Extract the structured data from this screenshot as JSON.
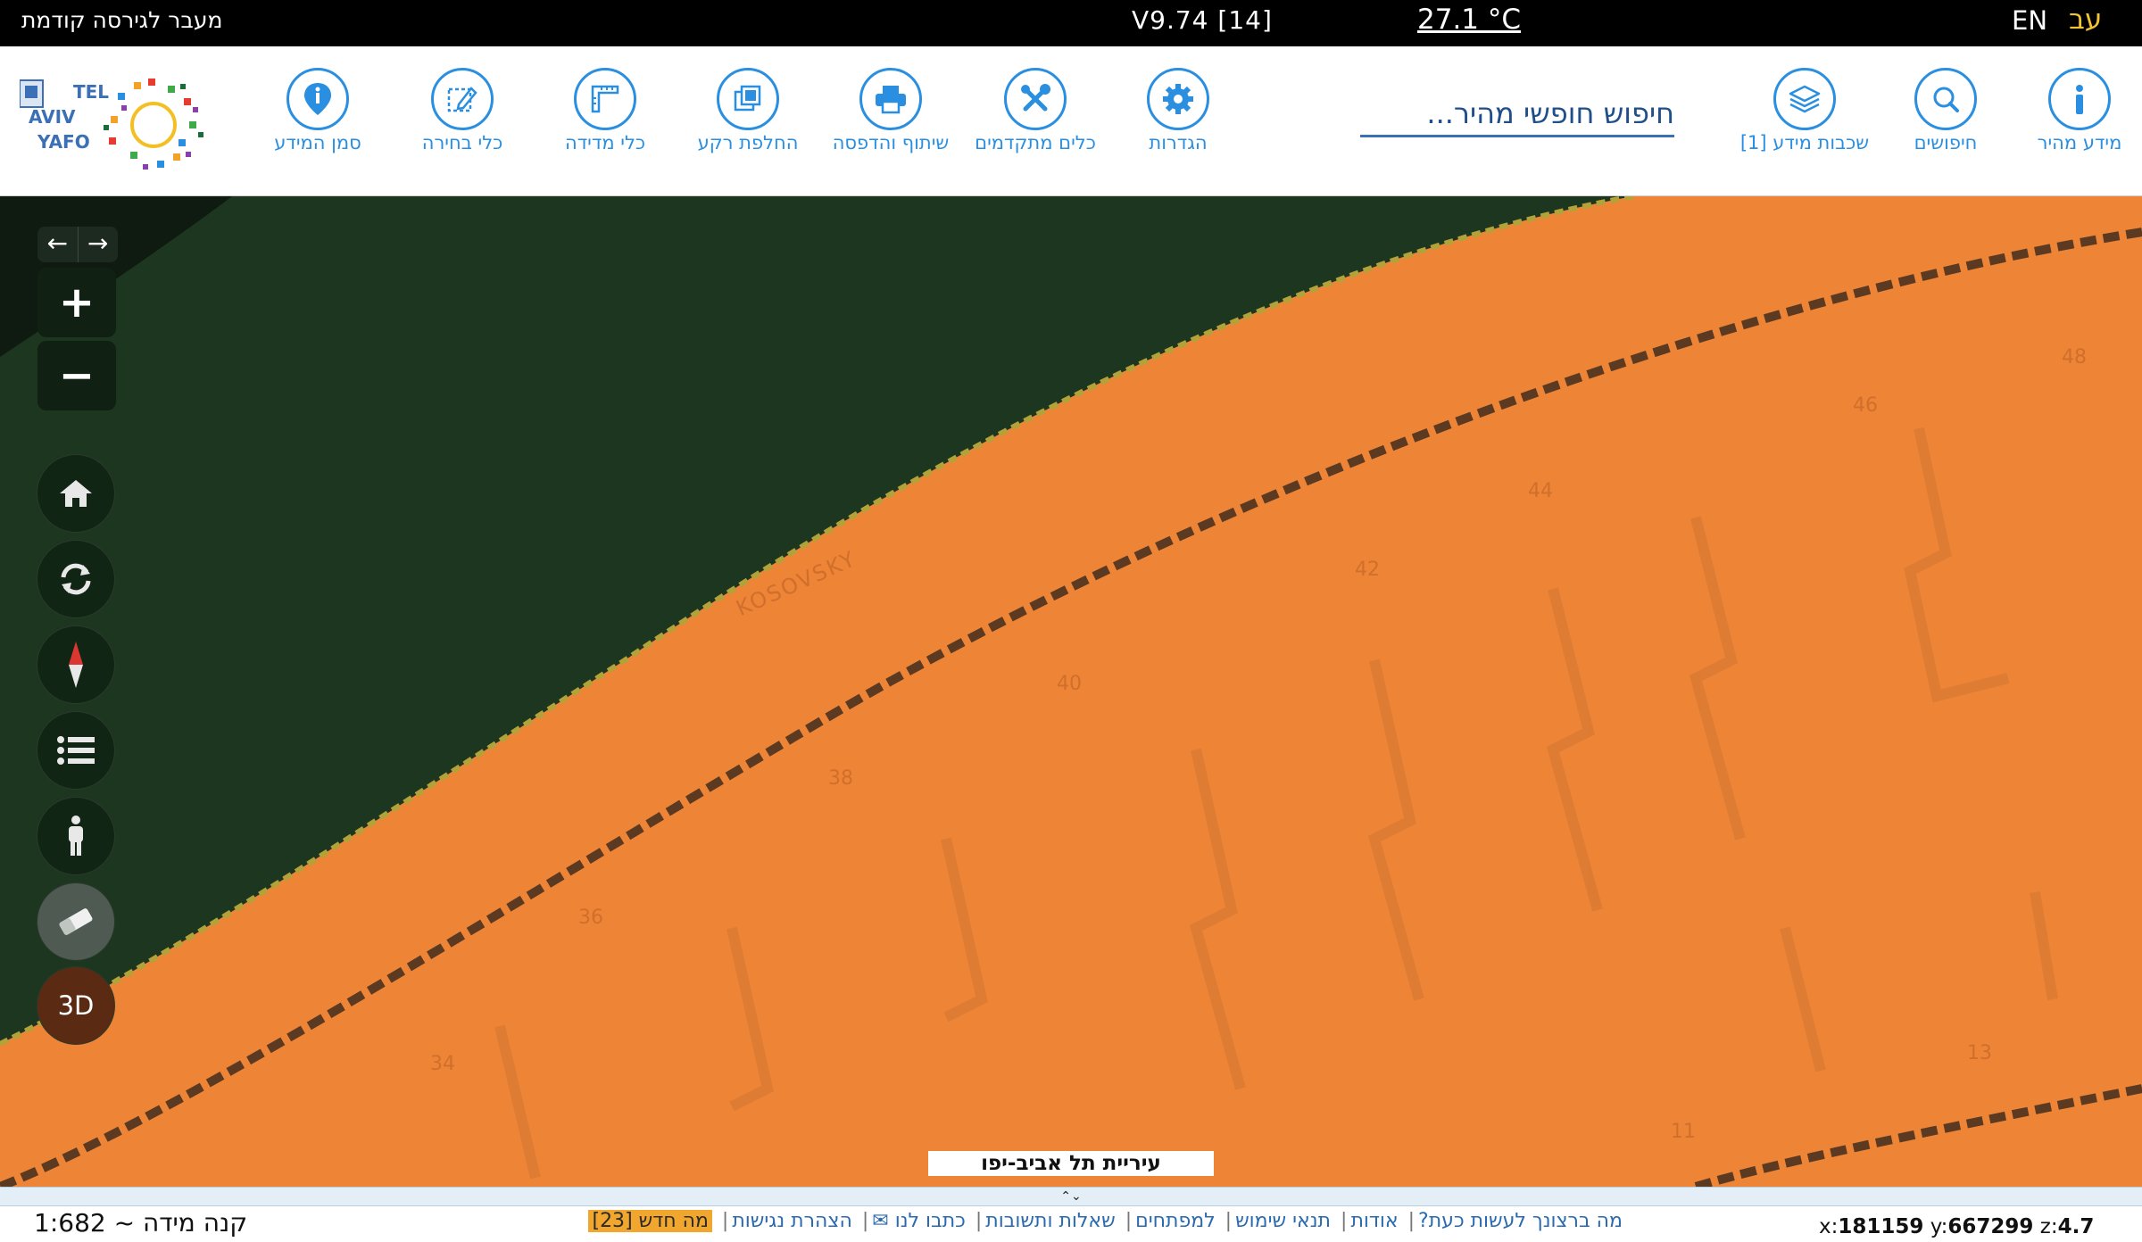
{
  "topbar": {
    "prev_version_link": "מעבר לגירסה קודמת",
    "version": "V9.74 [14]",
    "temperature": "27.1 °C",
    "lang_en": "EN",
    "lang_he": "עב"
  },
  "toolbar": {
    "logo_text": "תל אביב TEL AVIV YAFO יפו",
    "tools": [
      {
        "label": "סמן המידע",
        "icon": "map-pin-icon"
      },
      {
        "label": "כלי בחירה",
        "icon": "select-pen-icon"
      },
      {
        "label": "כלי מדידה",
        "icon": "ruler-icon"
      },
      {
        "label": "החלפת רקע",
        "icon": "swap-background-icon"
      },
      {
        "label": "שיתוף והדפסה",
        "icon": "printer-icon"
      },
      {
        "label": "כלים מתקדמים",
        "icon": "tools-icon"
      },
      {
        "label": "הגדרות",
        "icon": "gear-icon"
      },
      {
        "label": "שכבות מידע [1]",
        "icon": "layers-icon"
      },
      {
        "label": "חיפושים",
        "icon": "search-icon"
      },
      {
        "label": "מידע מהיר",
        "icon": "info-icon"
      }
    ],
    "search_placeholder": "חיפוש חופשי מהיר..."
  },
  "map": {
    "street_label": "KOSOVSKY",
    "house_numbers": [
      "48",
      "46",
      "44",
      "42",
      "40",
      "38",
      "36",
      "34",
      "13",
      "11"
    ],
    "footer_label": "עיריית תל אביב-יפו",
    "controls": {
      "zoom_in": "+",
      "zoom_out": "−",
      "mode_3d": "3D",
      "back_arrow": "←",
      "forward_arrow": "→"
    },
    "colors": {
      "land": "#ee8436",
      "park": "#1d3620",
      "road_line": "#5c3a22"
    }
  },
  "bottom": {
    "handle_glyph": "⌃⌄",
    "scale": "קנה מידה ~ 1:682",
    "links": [
      "מה ברצונך לעשות כעת?",
      "אודות",
      "תנאי שימוש",
      "למפתחים",
      "שאלות ותשובות",
      "כתבו לנו ✉",
      "הצהרת נגישות"
    ],
    "whats_new": "מה חדש [23]",
    "coords": {
      "x_label": "x:",
      "x": "181159",
      "y_label": "y:",
      "y": "667299",
      "z_label": "z:",
      "z": "4.7"
    }
  }
}
